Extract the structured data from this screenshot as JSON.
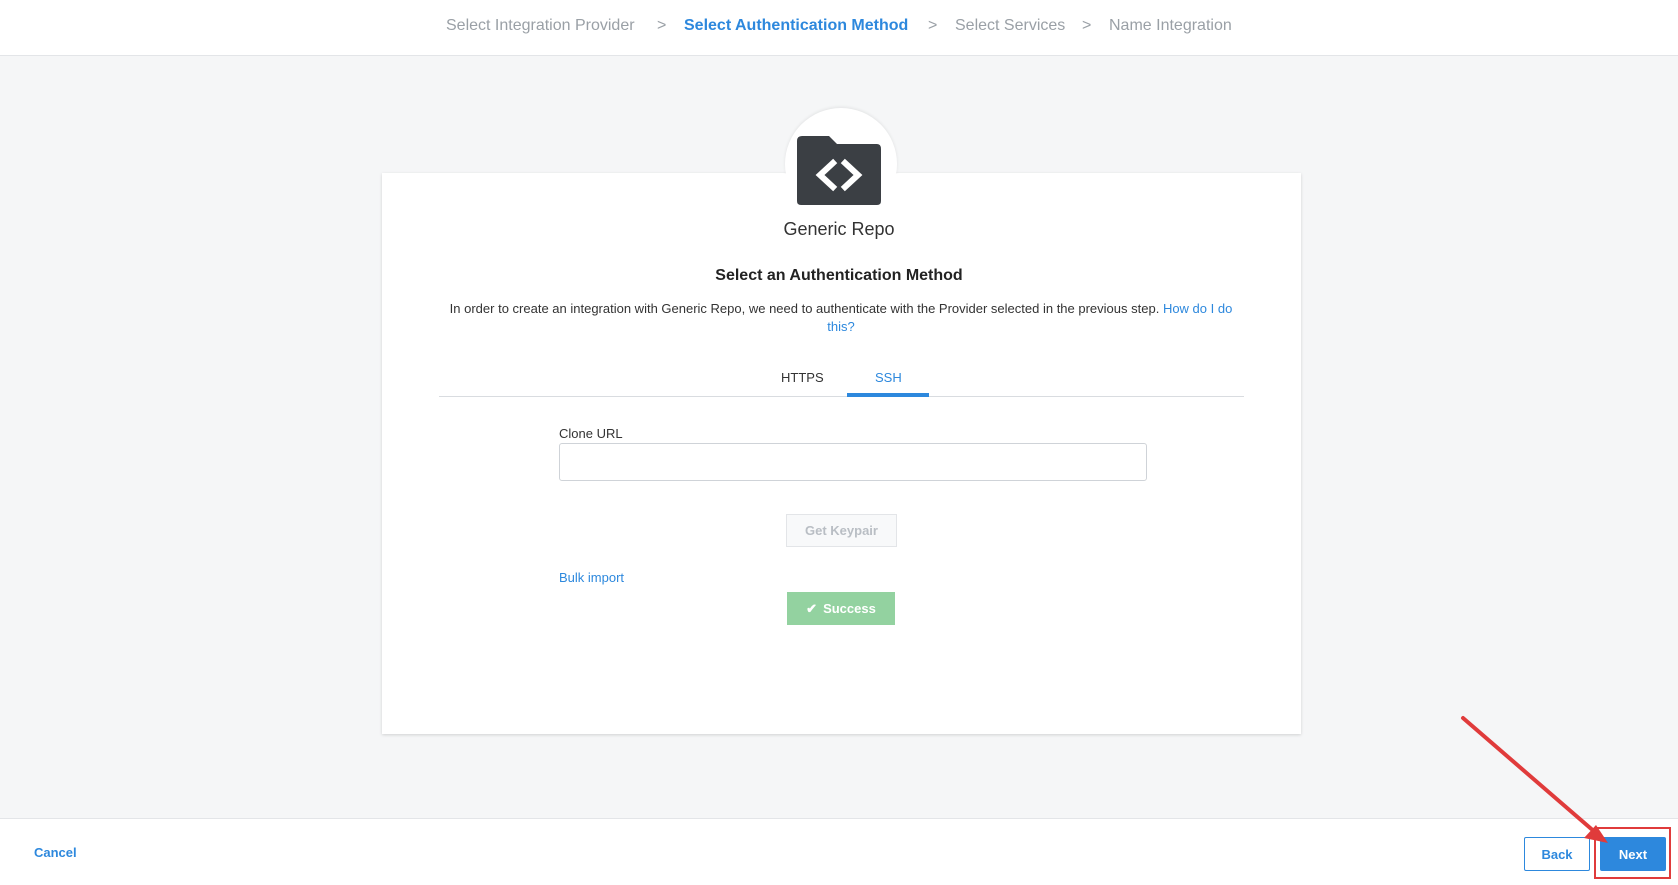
{
  "stepper": {
    "steps": [
      "Select Integration Provider",
      "Select Authentication Method",
      "Select Services",
      "Name Integration"
    ],
    "separator": ">",
    "active_index": 1
  },
  "card": {
    "provider_name": "Generic Repo",
    "logo_icon": "code-folder-icon",
    "title": "Select an Authentication Method",
    "description": "In order to create an integration with Generic Repo, we need to authenticate with the Provider selected in the previous step.",
    "help_link": "How do I do this?",
    "tabs": [
      {
        "label": "HTTPS",
        "active": false
      },
      {
        "label": "SSH",
        "active": true
      }
    ],
    "clone_url": {
      "label": "Clone URL",
      "value": "",
      "placeholder": ""
    },
    "get_keypair_label": "Get Keypair",
    "bulk_import_label": "Bulk import",
    "success_label": "Success"
  },
  "footer": {
    "cancel_label": "Cancel",
    "back_label": "Back",
    "next_label": "Next"
  },
  "colors": {
    "accent": "#2d88dd",
    "success": "#93d2a0",
    "annotation": "#e03b3b"
  }
}
